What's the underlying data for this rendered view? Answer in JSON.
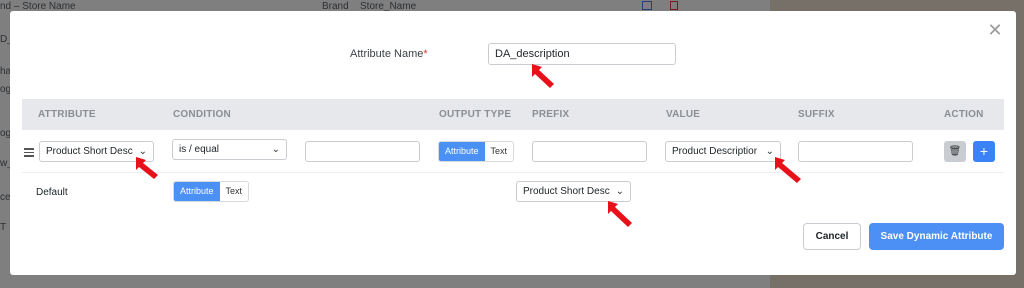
{
  "background": {
    "header_cols": [
      "nd – Store Name",
      "Brand",
      "Store_Name"
    ],
    "side_rows": [
      "D_A",
      "hac",
      "og",
      "og",
      "w_",
      "ce",
      "T"
    ]
  },
  "modal": {
    "close_icon": "close-icon",
    "attribute_name_label": "Attribute Name",
    "required_mark": "*",
    "attribute_name_value": "DA_description",
    "table_headers": {
      "attribute": "ATTRIBUTE",
      "condition": "CONDITION",
      "output_type": "OUTPUT TYPE",
      "prefix": "PREFIX",
      "value": "VALUE",
      "suffix": "SUFFIX",
      "action": "ACTION"
    },
    "row": {
      "attribute_select": "Product Short Desc",
      "condition_select": "is / equal",
      "condition_input": "",
      "output_type": {
        "attribute": "Attribute",
        "text": "Text",
        "active": "Attribute"
      },
      "prefix_input": "",
      "value_select": "Product Descriptior",
      "suffix_input": "",
      "action_icons": [
        "trash-icon",
        "plus-icon"
      ]
    },
    "default_row": {
      "label": "Default",
      "output_type": {
        "attribute": "Attribute",
        "text": "Text",
        "active": "Attribute"
      },
      "value_select": "Product Short Desc"
    },
    "buttons": {
      "cancel": "Cancel",
      "save": "Save Dynamic Attribute"
    }
  },
  "colors": {
    "primary": "#4c8ff5",
    "annotation_arrow": "#e8111a",
    "required": "#d63638"
  }
}
